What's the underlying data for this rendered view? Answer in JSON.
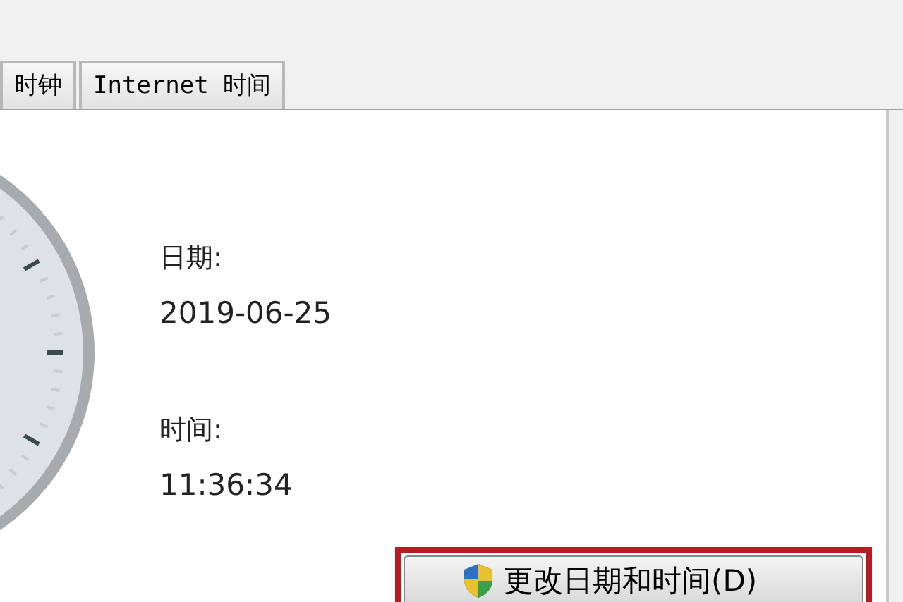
{
  "tabs": [
    {
      "label": "时钟",
      "selected": false
    },
    {
      "label": "Internet 时间",
      "selected": false
    }
  ],
  "date": {
    "label": "日期:",
    "value": "2019-06-25"
  },
  "time": {
    "label": "时间:",
    "value": "11:36:34"
  },
  "change_button": {
    "label": "更改日期和时间(D)",
    "highlighted": true
  }
}
